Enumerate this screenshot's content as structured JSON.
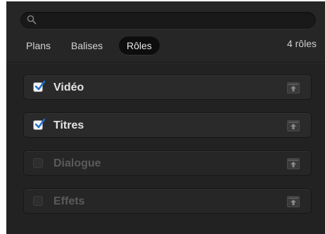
{
  "search": {
    "placeholder": "",
    "value": ""
  },
  "tabs": [
    {
      "label": "Plans",
      "active": false
    },
    {
      "label": "Balises",
      "active": false
    },
    {
      "label": "Rôles",
      "active": true
    }
  ],
  "roles_count": "4 rôles",
  "roles": [
    {
      "label": "Vidéo",
      "checked": true,
      "icon": "expand-arrow-icon"
    },
    {
      "label": "Titres",
      "checked": true,
      "icon": "expand-arrow-icon"
    },
    {
      "label": "Dialogue",
      "checked": false,
      "icon": "expand-arrow-icon"
    },
    {
      "label": "Effets",
      "checked": false,
      "icon": "expand-arrow-icon"
    }
  ],
  "colors": {
    "panel_background": "#222222",
    "checkbox_accent": "#1e6fd0"
  }
}
